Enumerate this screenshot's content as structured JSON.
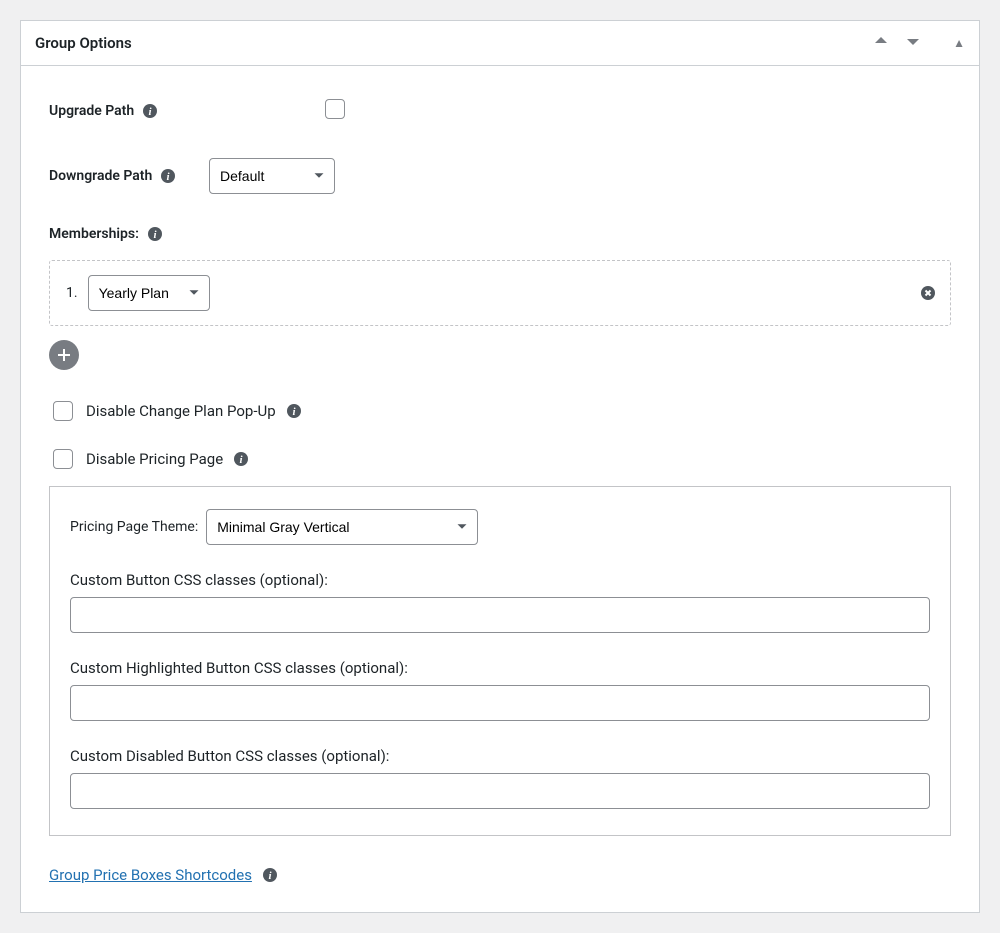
{
  "panel": {
    "title": "Group Options"
  },
  "fields": {
    "upgrade_path_label": "Upgrade Path",
    "downgrade_path_label": "Downgrade Path",
    "downgrade_path_value": "Default",
    "memberships_label": "Memberships:",
    "membership_item": {
      "index": "1.",
      "value": "Yearly Plan"
    },
    "disable_popup_label": "Disable Change Plan Pop-Up",
    "disable_pricing_label": "Disable Pricing Page",
    "pricing_theme_label": "Pricing Page Theme:",
    "pricing_theme_value": "Minimal Gray Vertical",
    "custom_btn_label": "Custom Button CSS classes (optional):",
    "custom_hl_btn_label": "Custom Highlighted Button CSS classes (optional):",
    "custom_dis_btn_label": "Custom Disabled Button CSS classes (optional):",
    "footer_link_text": "Group Price Boxes Shortcodes"
  }
}
